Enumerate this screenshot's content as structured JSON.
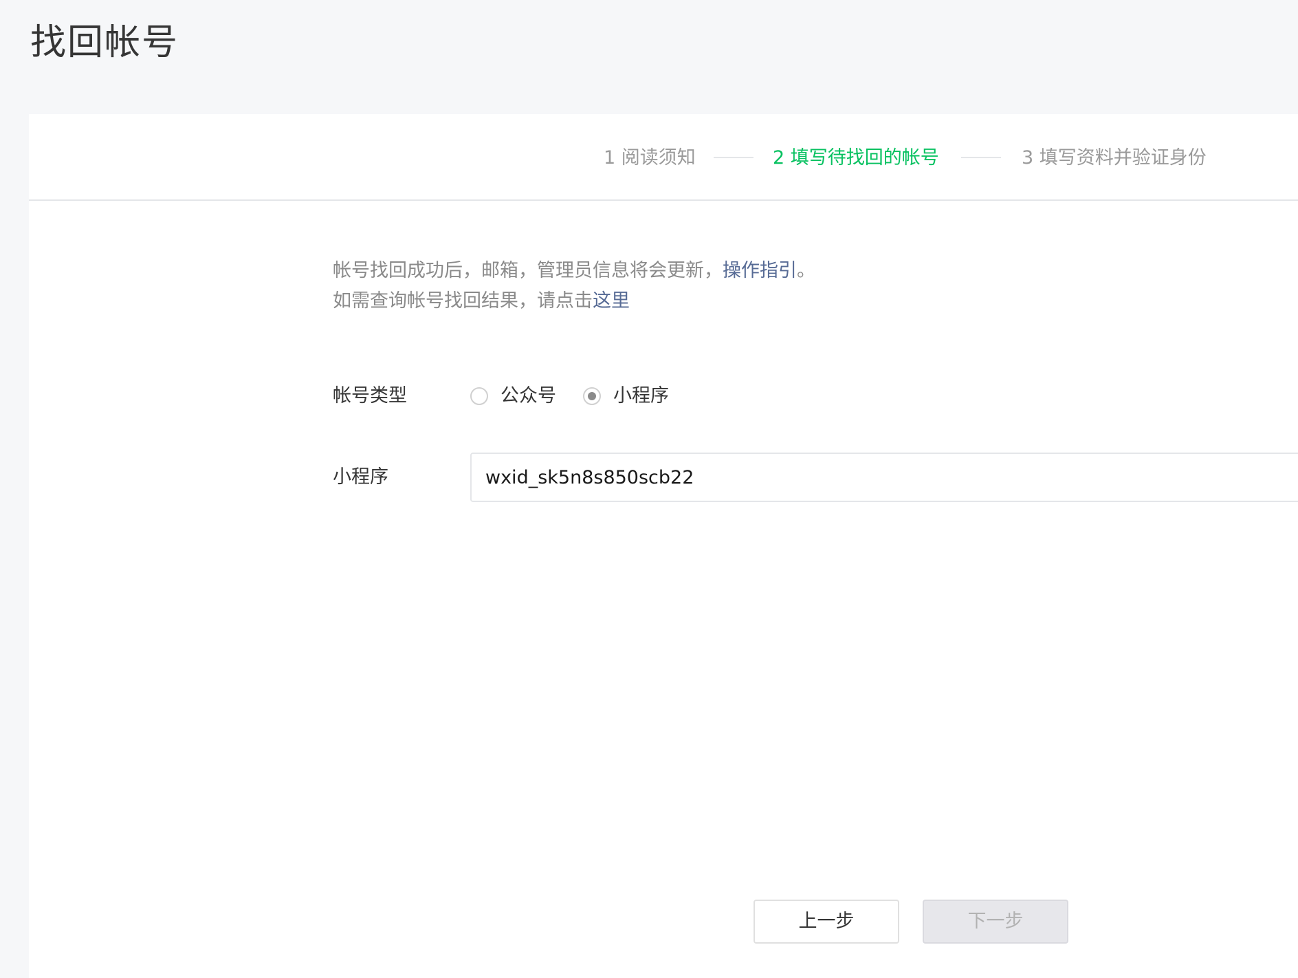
{
  "page": {
    "title": "找回帐号"
  },
  "steps": [
    {
      "label": "1 阅读须知",
      "state": "done"
    },
    {
      "label": "2 填写待找回的帐号",
      "state": "active"
    },
    {
      "label": "3 填写资料并验证身份",
      "state": "pending"
    }
  ],
  "notice": {
    "line1_text": "帐号找回成功后，邮箱，管理员信息将会更新，",
    "line1_link": "操作指引",
    "line1_end": "。",
    "line2_text": "如需查询帐号找回结果，请点击",
    "line2_link": "这里"
  },
  "form": {
    "account_type_label": "帐号类型",
    "options": [
      {
        "label": "公众号",
        "checked": false
      },
      {
        "label": "小程序",
        "checked": true
      }
    ],
    "account_label": "小程序",
    "account_value": "wxid_sk5n8s850scb22"
  },
  "buttons": {
    "prev": "上一步",
    "next": "下一步"
  },
  "colors": {
    "accent": "#07c160",
    "link": "#576b95",
    "muted": "#8a8a8a"
  }
}
